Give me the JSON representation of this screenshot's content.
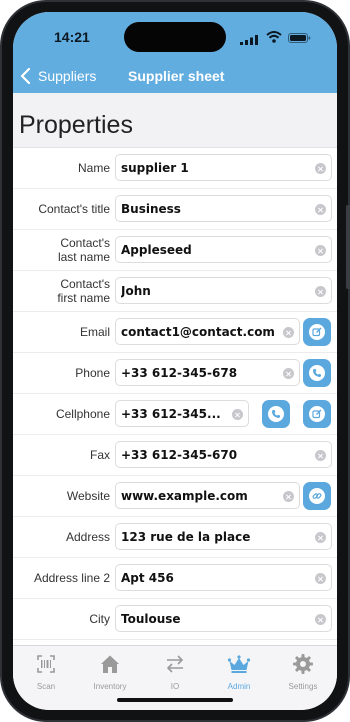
{
  "status_bar": {
    "time": "14:21"
  },
  "nav": {
    "back_label": "Suppliers",
    "title": "Supplier sheet"
  },
  "section": {
    "title": "Properties"
  },
  "fields": [
    {
      "label": "Name",
      "value": "supplier 1"
    },
    {
      "label": "Contact's title",
      "value": "Business"
    },
    {
      "label": "Contact's\nlast name",
      "value": "Appleseed"
    },
    {
      "label": "Contact's\nfirst name",
      "value": "John"
    },
    {
      "label": "Email",
      "value": "contact1@contact.com"
    },
    {
      "label": "Phone",
      "value": "+33 612-345-678"
    },
    {
      "label": "Cellphone",
      "value": "+33 612-345..."
    },
    {
      "label": "Fax",
      "value": "+33 612-345-670"
    },
    {
      "label": "Website",
      "value": "www.example.com"
    },
    {
      "label": "Address",
      "value": "123 rue de la place"
    },
    {
      "label": "Address line 2",
      "value": "Apt 456"
    },
    {
      "label": "City",
      "value": "Toulouse"
    }
  ],
  "tabs": [
    {
      "label": "Scan",
      "icon": "barcode-scan-icon"
    },
    {
      "label": "Inventory",
      "icon": "house-icon"
    },
    {
      "label": "IO",
      "icon": "arrows-in-out-icon"
    },
    {
      "label": "Admin",
      "icon": "crown-icon"
    },
    {
      "label": "Settings",
      "icon": "gear-icon"
    }
  ],
  "colors": {
    "accent": "#5aa8de",
    "header": "#62ade0",
    "inactive_tab": "#9a9a9a"
  }
}
